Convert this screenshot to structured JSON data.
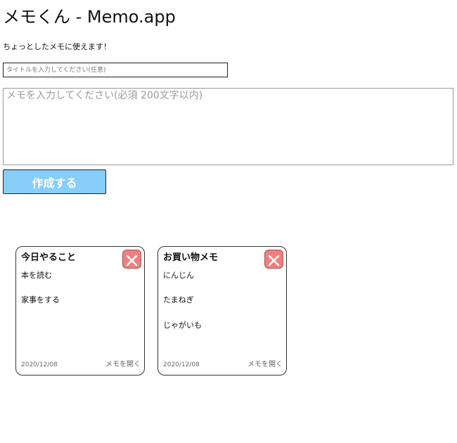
{
  "header": {
    "title": "メモくん - Memo.app",
    "tagline": "ちょっとしたメモに使えます！"
  },
  "form": {
    "title_placeholder": "タイトルを入力してください(任意)",
    "title_value": "",
    "memo_placeholder": "メモを入力してください(必須 200文字以内)",
    "memo_value": "",
    "submit_label": "作成する"
  },
  "memos": [
    {
      "title": "今日やること",
      "lines": [
        "本を読む",
        "",
        "家事をする"
      ],
      "date": "2020/12/08",
      "open_label": "メモを開く"
    },
    {
      "title": "お買い物メモ",
      "lines": [
        "にんじん",
        "",
        "たまねぎ",
        "",
        "じゃがいも"
      ],
      "date": "2020/12/08",
      "open_label": "メモを開く"
    }
  ],
  "colors": {
    "submit_bg": "#87cefa",
    "close_bg": "#f08080"
  },
  "icons": {
    "delete": "close-icon"
  }
}
